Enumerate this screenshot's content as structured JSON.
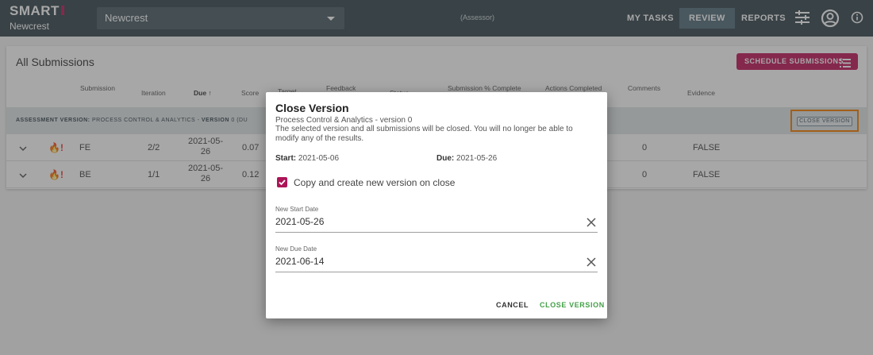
{
  "header": {
    "brand": "SMART",
    "brand_subtitle": "Newcrest",
    "org_select_value": "Newcrest",
    "role": "(Assessor)",
    "nav": {
      "my_tasks": "MY TASKS",
      "review": "REVIEW",
      "reports": "REPORTS"
    },
    "icons": [
      "sliders-icon",
      "account-circle-icon",
      "info-icon"
    ]
  },
  "colors": {
    "topbar": "#37474f",
    "accent": "#c2185b",
    "highlight": "#f57c00",
    "confirm": "#43a047"
  },
  "page": {
    "title": "All Submissions",
    "schedule_button": "SCHEDULE SUBMISSIONS",
    "columns": [
      "Submission",
      "Iteration",
      "Due",
      "Score",
      "Target",
      "Feedback",
      "Status",
      "Submission % Complete",
      "Actions Completed",
      "Comments",
      "Evidence"
    ],
    "sorted_column": "Due",
    "version_bar": {
      "label_key": "ASSESSMENT VERSION:",
      "label_value": "PROCESS CONTROL & ANALYTICS -",
      "version_key": "VERSION",
      "version_value": "0 (DU",
      "close_button": "CLOSE VERSION"
    },
    "rows": [
      {
        "submission": "FE",
        "iteration": "2/2",
        "due_line1": "2021-05-",
        "due_line2": "26",
        "score": "0.07",
        "comments": "0",
        "evidence": "FALSE"
      },
      {
        "submission": "BE",
        "iteration": "1/1",
        "due_line1": "2021-05-",
        "due_line2": "26",
        "score": "0.12",
        "comments": "0",
        "evidence": "FALSE"
      }
    ]
  },
  "dialog": {
    "title": "Close Version",
    "subtitle": "Process Control & Analytics - version 0",
    "description": "The selected version and all submissions will be closed. You will no longer be able to modify any of the results.",
    "start_label": "Start:",
    "start_value": "2021-05-06",
    "due_label": "Due:",
    "due_value": "2021-05-26",
    "checkbox_label": "Copy and create new version on close",
    "checkbox_checked": true,
    "new_start_label": "New Start Date",
    "new_start_value": "2021-05-26",
    "new_due_label": "New Due Date",
    "new_due_value": "2021-06-14",
    "cancel": "CANCEL",
    "confirm": "CLOSE VERSION"
  }
}
